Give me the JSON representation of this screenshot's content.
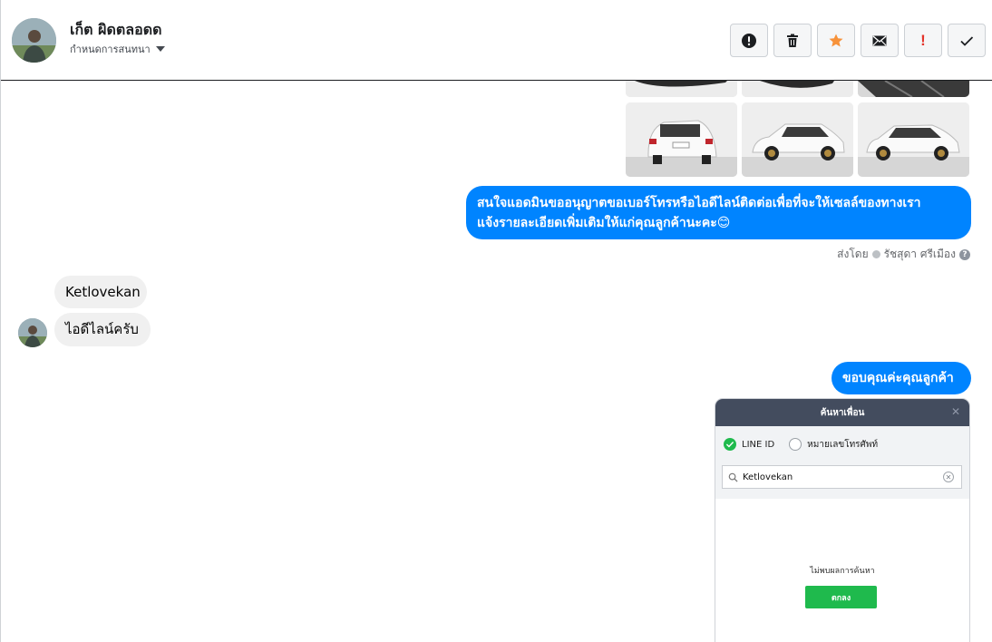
{
  "header": {
    "contact_name": "เก็ต ผิดตลอดด",
    "contact_sub": "กำหนดการสนทนา"
  },
  "toolbar": {
    "buttons": [
      {
        "name": "report",
        "icon": "exclamation-circle-icon"
      },
      {
        "name": "delete",
        "icon": "trash-icon"
      },
      {
        "name": "star",
        "icon": "star-icon",
        "color": "#f7923a"
      },
      {
        "name": "email",
        "icon": "envelope-icon"
      },
      {
        "name": "important",
        "label": "!",
        "color": "#e4332a"
      },
      {
        "name": "done",
        "icon": "check-icon"
      }
    ]
  },
  "messages": {
    "outgoing_1": {
      "line1": "สนใจแอดมินขออนุญาตขอเบอร์โทรหรือไอดีไลน์ติดต่อเพื่อที่จะให้เซลล์ของทางเรา",
      "line2": "แจ้งรายละเอียดเพิ่มเติมให้แก่คุณลูกค้านะคะ😊"
    },
    "sent_by_prefix": "ส่งโดย",
    "sent_by_name": "รัชสุดา ศรีเมือง",
    "incoming_1": "Ketlovekan",
    "incoming_2": "ไอดีไลน์ครับ",
    "outgoing_2": "ขอบคุณค่ะคุณลูกค้า"
  },
  "line_screenshot": {
    "title": "ค้นหาเพื่อน",
    "option_line_id": "LINE ID",
    "option_phone": "หมายเลขโทรศัพท์",
    "search_value": "Ketlovekan",
    "empty_text": "ไม่พบผลการค้นหา",
    "ok_label": "ตกลง",
    "accent": "#1fba4d"
  },
  "colors": {
    "outgoing_bubble": "#0084ff",
    "incoming_bubble": "#f0f0f0"
  }
}
